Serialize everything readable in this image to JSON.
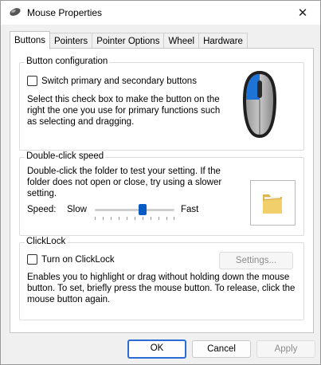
{
  "window": {
    "title": "Mouse Properties",
    "close_glyph": "✕"
  },
  "tabs": [
    {
      "label": "Buttons"
    },
    {
      "label": "Pointers"
    },
    {
      "label": "Pointer Options"
    },
    {
      "label": "Wheel"
    },
    {
      "label": "Hardware"
    }
  ],
  "button_config": {
    "legend": "Button configuration",
    "checkbox_label": "Switch primary and secondary buttons",
    "checked": false,
    "description_lines": [
      "Select this check box to make the button on the",
      "right the one you use for primary functions such",
      "as selecting and dragging."
    ]
  },
  "double_click": {
    "legend": "Double-click speed",
    "description_lines": [
      "Double-click the folder to test your setting. If the",
      "folder does not open or close, try using a slower",
      "setting."
    ],
    "speed_label": "Speed:",
    "slow_label": "Slow",
    "fast_label": "Fast",
    "slider_value": 0.6
  },
  "clicklock": {
    "legend": "ClickLock",
    "checkbox_label": "Turn on ClickLock",
    "checked": false,
    "settings_button": "Settings...",
    "description_lines": [
      "Enables you to highlight or drag without holding down the mouse",
      "button. To set, briefly press the mouse button. To release, click the",
      "mouse button again."
    ]
  },
  "footer": {
    "ok": "OK",
    "cancel": "Cancel",
    "apply": "Apply"
  },
  "colors": {
    "accent": "#0a5bc4",
    "mouse_highlight": "#1e73d6"
  }
}
